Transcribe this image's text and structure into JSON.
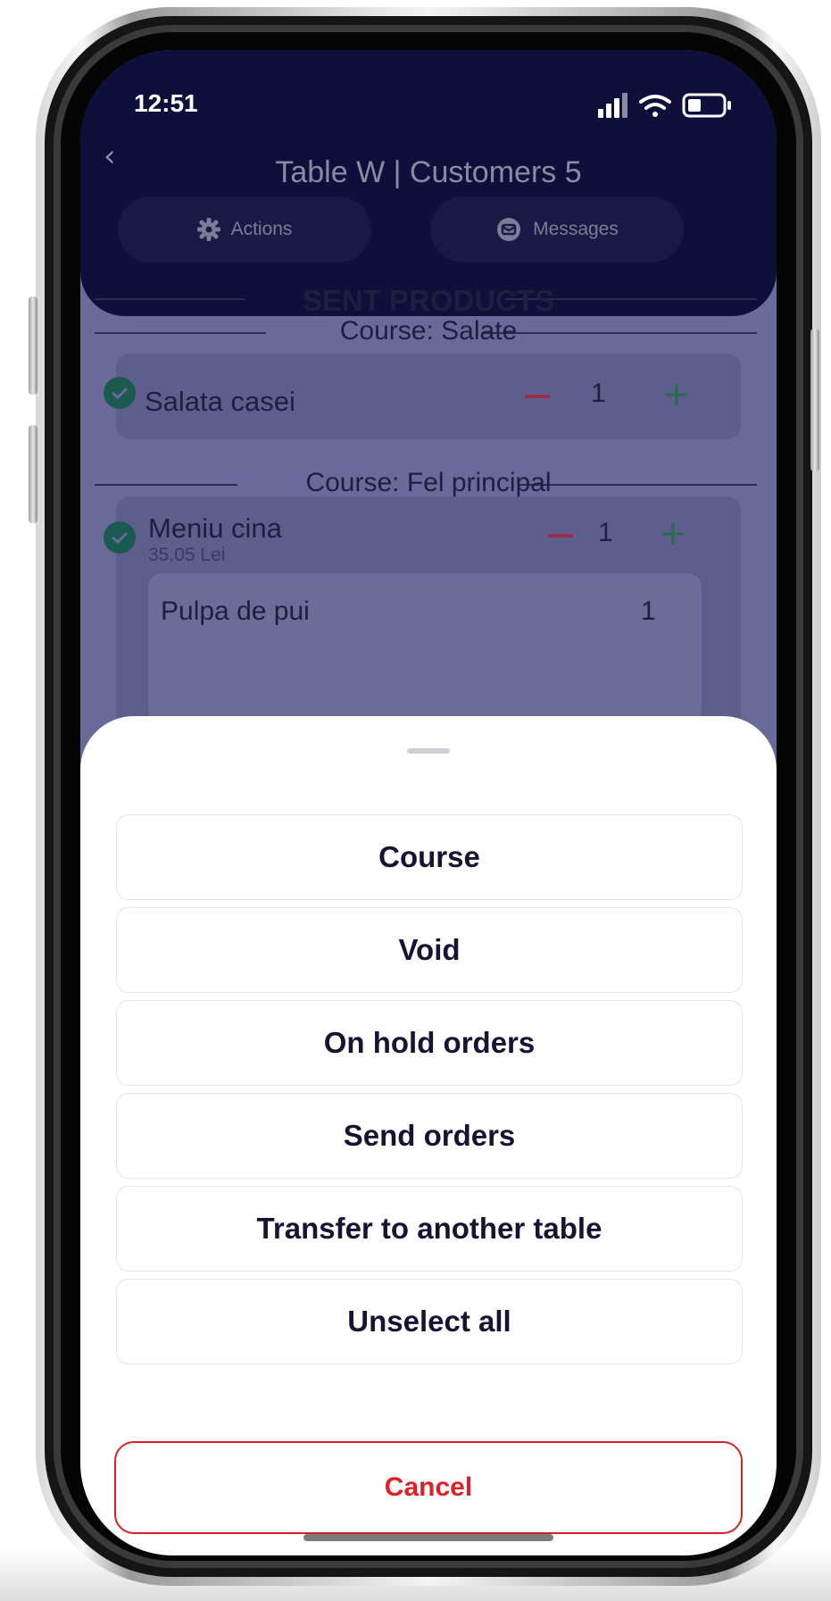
{
  "status_bar": {
    "time": "12:51"
  },
  "header": {
    "title": "Table W | Customers 5",
    "actions_label": "Actions",
    "messages_label": "Messages"
  },
  "order": {
    "section_title": "SENT PRODUCTS",
    "course1_label": "Course: Salate",
    "course2_label": "Course: Fel principal",
    "items": [
      {
        "name": "Salata casei",
        "qty": "1"
      },
      {
        "name": "Meniu cina",
        "price": "35.05 Lei",
        "qty": "1",
        "sub_item": {
          "name": "Pulpa de pui",
          "qty": "1"
        }
      }
    ]
  },
  "sheet": {
    "options": [
      "Course",
      "Void",
      "On hold orders",
      "Send orders",
      "Transfer to another table",
      "Unselect all"
    ],
    "cancel_label": "Cancel"
  },
  "colors": {
    "cancel": "#e01f26",
    "header_bg": "#0f0f3c",
    "sheet_bg": "#ffffff"
  }
}
